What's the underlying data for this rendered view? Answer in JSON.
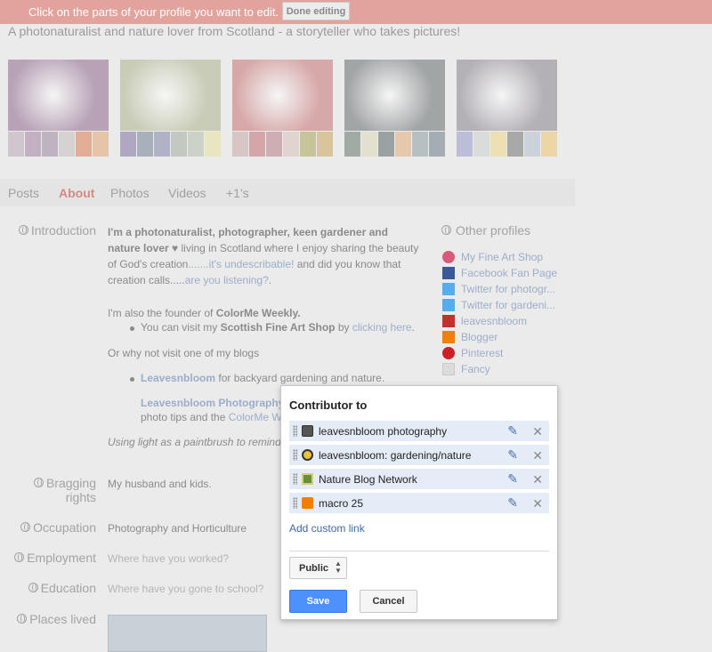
{
  "topbar": {
    "message": "Click on the parts of your profile you want to edit.",
    "done_label": "Done editing"
  },
  "tagline": "A photonaturalist and nature lover from Scotland - a storyteller who takes pictures!",
  "gallery": [
    {
      "photo_color": "#b7a2b6",
      "swatches": [
        "#cfc6cf",
        "#c3b1c3",
        "#bfb3bf",
        "#d7d2d2",
        "#e2ad96",
        "#e5c4a8"
      ]
    },
    {
      "photo_color": "#c9ccb7",
      "swatches": [
        "#b0a7c3",
        "#a8b0bb",
        "#afb3c5",
        "#c3c9c0",
        "#cdd2c7",
        "#e8e5c0"
      ]
    },
    {
      "photo_color": "#d7a8a8",
      "swatches": [
        "#d8c5c6",
        "#d3a7aa",
        "#cfaeb3",
        "#e1d4cf",
        "#c8c49a",
        "#d9c59b"
      ]
    },
    {
      "photo_color": "#a2a5a6",
      "swatches": [
        "#a2aaa4",
        "#e2e1d0",
        "#9aa1a3",
        "#e6c9ad",
        "#b6c0c3",
        "#a4adb3"
      ]
    },
    {
      "photo_color": "#b3b0b6",
      "swatches": [
        "#bcbdd9",
        "#d9dcd8",
        "#ecdfb1",
        "#a9a8a9",
        "#ccd2da",
        "#ecd6a7"
      ]
    }
  ],
  "tabs": [
    "Posts",
    "About",
    "Photos",
    "Videos",
    "+1's"
  ],
  "introduction": {
    "label": "Introduction",
    "bold_lead": "I'm a photonaturalist, photographer, keen gardener and nature lover",
    "heart": "♥",
    "text1": " living in Scotland where I enjoy sharing the beauty of God's creation",
    "link1": ".......it's undescribable!",
    "text2": " and did you know that creation calls.....",
    "link2": "are you listening?",
    "text3": ".",
    "founder_prefix": "I'm also the founder of ",
    "founder_link": "ColorMe Weekly.",
    "bullet1_prefix": "You can visit my ",
    "bullet1_bold": "Scottish Fine Art Shop",
    "bullet1_mid": " by  ",
    "bullet1_link": "clicking here",
    "bullet1_end": ".",
    "or_line": "Or why not visit one of my blogs",
    "bullet2_link": "Leavesnbloom",
    "bullet2_text": "  for backyard gardening and nature.",
    "bullet3_link": "Leavesnbloom Photography",
    "bullet3_text_a": "photo tips and the ",
    "bullet3_link2": "ColorMe We",
    "closing": "Using light as a paintbrush to remind"
  },
  "fields": {
    "bragging_label_1": "Bragging",
    "bragging_label_2": "rights",
    "bragging_value": "My husband and kids.",
    "occupation_label": "Occupation",
    "occupation_value": "Photography and Horticulture",
    "employment_label": "Employment",
    "employment_placeholder": "Where have you worked?",
    "education_label": "Education",
    "education_placeholder": "Where have you gone to school?",
    "places_label": "Places lived"
  },
  "other_profiles": {
    "heading": "Other profiles",
    "items": [
      {
        "label": "My Fine Art Shop",
        "icon": "shop-icon",
        "color": "#d95b7a"
      },
      {
        "label": "Facebook Fan Page",
        "icon": "facebook-icon",
        "color": "#3b5998"
      },
      {
        "label": "Twitter for photogr...",
        "icon": "twitter-icon",
        "color": "#55acee"
      },
      {
        "label": "Twitter for gardeni...",
        "icon": "twitter-icon",
        "color": "#55acee"
      },
      {
        "label": "leavesnbloom",
        "icon": "youtube-icon",
        "color": "#c4302b"
      },
      {
        "label": "Blogger",
        "icon": "blogger-icon",
        "color": "#f57d00"
      },
      {
        "label": "Pinterest",
        "icon": "pinterest-icon",
        "color": "#cb2027"
      },
      {
        "label": "Fancy",
        "icon": "fancy-icon",
        "color": "#dcdcdc"
      }
    ]
  },
  "dialog": {
    "title": "Contributor to",
    "items": [
      {
        "label": "leavesnbloom photography",
        "icon": "camera-icon"
      },
      {
        "label": "leavesnbloom: gardening/nature",
        "icon": "bee-icon"
      },
      {
        "label": "Nature Blog Network",
        "icon": "nature-network-icon"
      },
      {
        "label": "macro 25",
        "icon": "blogger-icon"
      }
    ],
    "add_link": "Add custom link",
    "visibility": "Public",
    "save_label": "Save",
    "cancel_label": "Cancel"
  }
}
